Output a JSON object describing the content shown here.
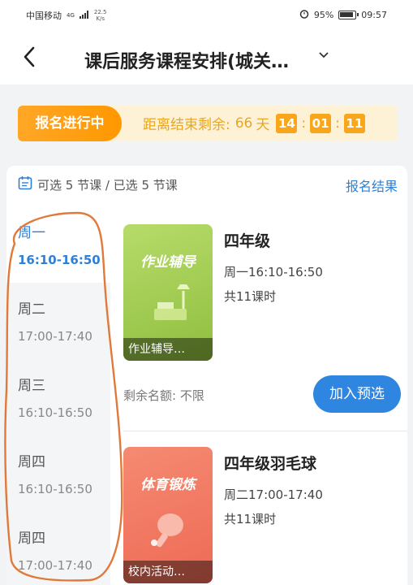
{
  "status_bar": {
    "carrier": "中国移动",
    "network": "4G",
    "speed_value": "22.5",
    "speed_unit": "K/s",
    "battery": "95%",
    "time": "09:57"
  },
  "header": {
    "back_icon": "chevron-left-icon",
    "title": "课后服务课程安排(城关…",
    "dropdown_icon": "chevron-down-icon"
  },
  "banner": {
    "badge": "报名进行中",
    "countdown_label": "距离结束剩余:",
    "days": "66",
    "days_unit": "天",
    "hours": "14",
    "minutes": "01",
    "seconds": "11",
    "colors": {
      "badge": "#ff9800",
      "background": "#fdf2d6",
      "text": "#e9a623"
    }
  },
  "summary": {
    "icon": "calendar-icon",
    "text": "可选 5 节课 / 已选 5 节课",
    "result_link": "报名结果"
  },
  "days": [
    {
      "name": "周一",
      "time": "16:10-16:50",
      "active": true
    },
    {
      "name": "周二",
      "time": "17:00-17:40",
      "active": false
    },
    {
      "name": "周三",
      "time": "16:10-16:50",
      "active": false
    },
    {
      "name": "周四",
      "time": "16:10-16:50",
      "active": false
    },
    {
      "name": "周四",
      "time": "17:00-17:40",
      "active": false
    }
  ],
  "courses": [
    {
      "thumb_title": "作业辅导",
      "thumb_caption": "作业辅导…",
      "title": "四年级",
      "time": "周一16:10-16:50",
      "hours": "共11课时",
      "quota": "剩余名额:  不限",
      "button": "加入预选",
      "thumb_color": "#a8cf5a"
    },
    {
      "thumb_title": "体育锻炼",
      "thumb_caption": "校内活动…",
      "title": "四年级羽毛球",
      "time": "周二17:00-17:40",
      "hours": "共11课时",
      "thumb_color": "#f27a66"
    }
  ],
  "accent_color": "#2e7fd6"
}
